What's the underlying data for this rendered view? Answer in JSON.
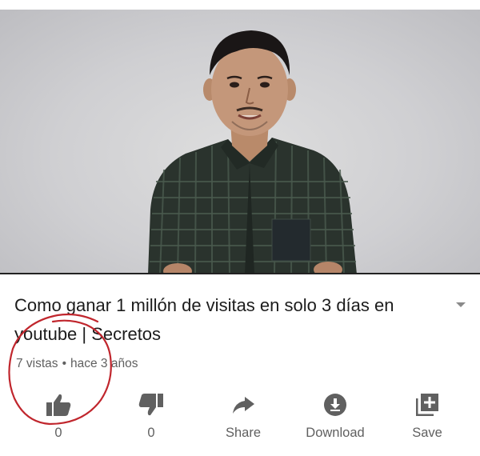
{
  "video": {
    "title": "Como ganar 1 millón de visitas en solo 3 días en youtube | Secretos"
  },
  "meta": {
    "views": "7 vistas",
    "separator": "•",
    "age": "hace 3 años"
  },
  "actions": [
    {
      "label": "0",
      "icon": "thumbs-up-icon"
    },
    {
      "label": "0",
      "icon": "thumbs-down-icon"
    },
    {
      "label": "Share",
      "icon": "share-icon"
    },
    {
      "label": "Download",
      "icon": "download-icon"
    },
    {
      "label": "Save",
      "icon": "save-icon"
    }
  ],
  "colors": {
    "text": "#1c1c1c",
    "secondary": "#606060",
    "annotation": "#c0262d"
  }
}
